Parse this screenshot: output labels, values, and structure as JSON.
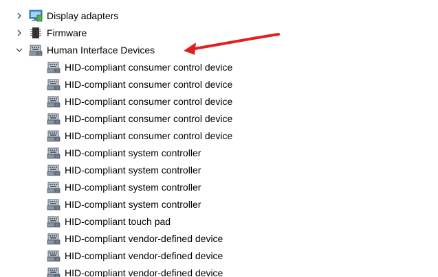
{
  "tree": {
    "categories": [
      {
        "label": "Display adapters",
        "expanded": false,
        "icon": "display-adapter-icon"
      },
      {
        "label": "Firmware",
        "expanded": false,
        "icon": "firmware-chip-icon"
      },
      {
        "label": "Human Interface Devices",
        "expanded": true,
        "icon": "hid-keyboard-icon"
      }
    ],
    "hid_children": [
      "HID-compliant consumer control device",
      "HID-compliant consumer control device",
      "HID-compliant consumer control device",
      "HID-compliant consumer control device",
      "HID-compliant consumer control device",
      "HID-compliant system controller",
      "HID-compliant system controller",
      "HID-compliant system controller",
      "HID-compliant system controller",
      "HID-compliant touch pad",
      "HID-compliant vendor-defined device",
      "HID-compliant vendor-defined device",
      "HID-compliant vendor-defined device"
    ]
  },
  "annotation": {
    "arrow_color": "#e02020"
  }
}
